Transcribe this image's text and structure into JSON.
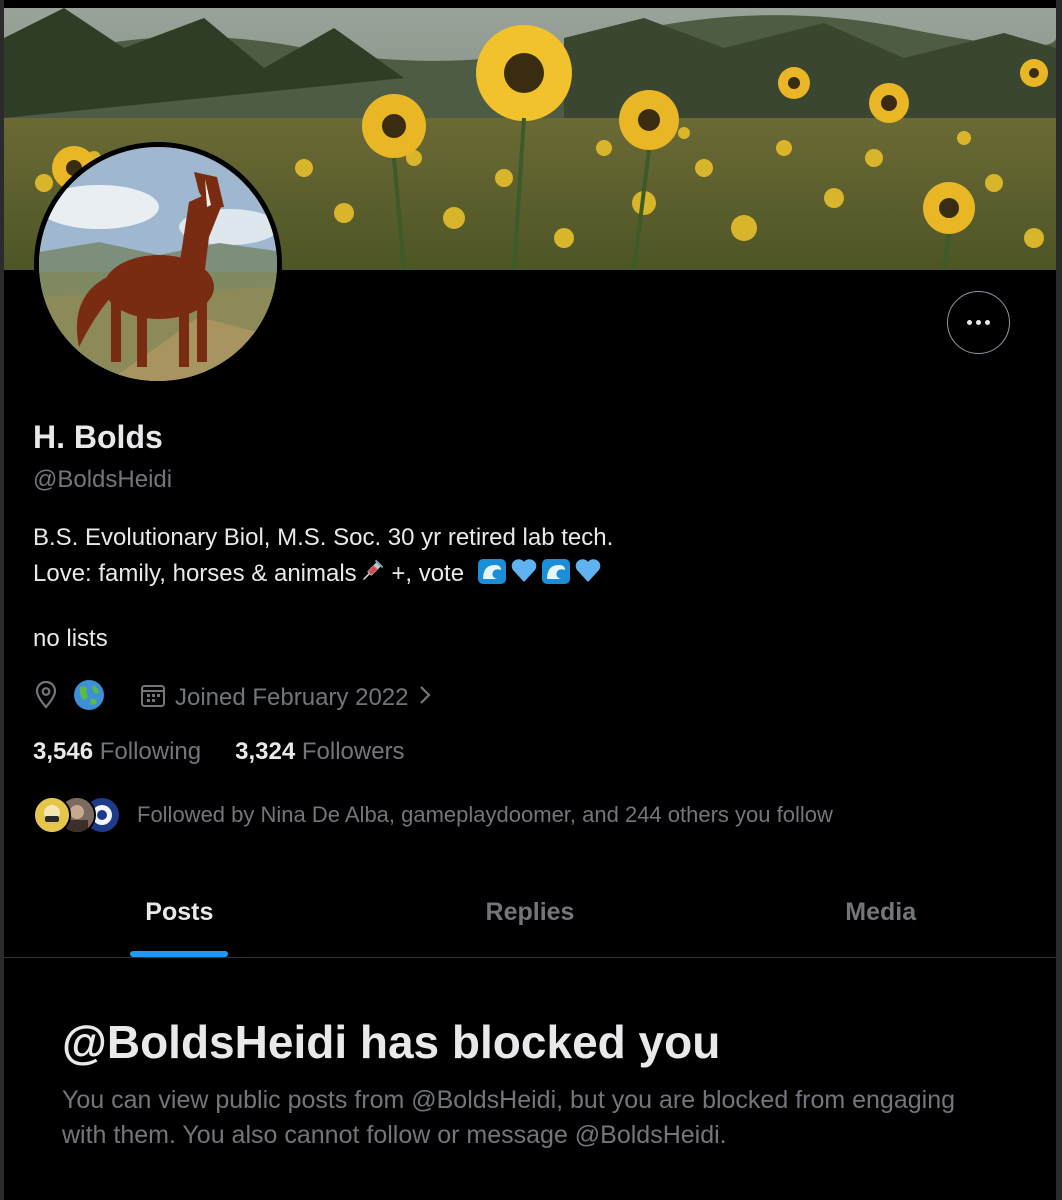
{
  "profile": {
    "name": "H. Bolds",
    "handle": "@BoldsHeidi",
    "bio_line1": "B.S. Evolutionary Biol, M.S. Soc. 30 yr retired lab tech.",
    "bio_line2": "Love: family, horses & animals",
    "bio_line2_suffix": " +, vote",
    "bio_line3": "no lists",
    "joined": "Joined February 2022",
    "following_count": "3,546",
    "following_label": "Following",
    "followers_count": "3,324",
    "followers_label": "Followers",
    "followed_by": "Followed by Nina De Alba, gameplaydoomer, and 244 others you follow"
  },
  "icons": {
    "more": "more-horizontal-icon",
    "location": "location-pin-icon",
    "globe": "globe-emoji",
    "calendar": "calendar-icon",
    "chevron": "chevron-right-icon"
  },
  "tabs": [
    {
      "label": "Posts",
      "active": true
    },
    {
      "label": "Replies",
      "active": false
    },
    {
      "label": "Media",
      "active": false
    }
  ],
  "blocked": {
    "title": "@BoldsHeidi has blocked you",
    "message": "You can view public posts from @BoldsHeidi, but you are blocked from engaging with them. You also cannot follow or message @BoldsHeidi."
  },
  "colors": {
    "background": "#000000",
    "text_primary": "#e7e9ea",
    "text_secondary": "#71767b",
    "accent": "#1d9bf0",
    "heart_blue": "#5fb3f0"
  }
}
